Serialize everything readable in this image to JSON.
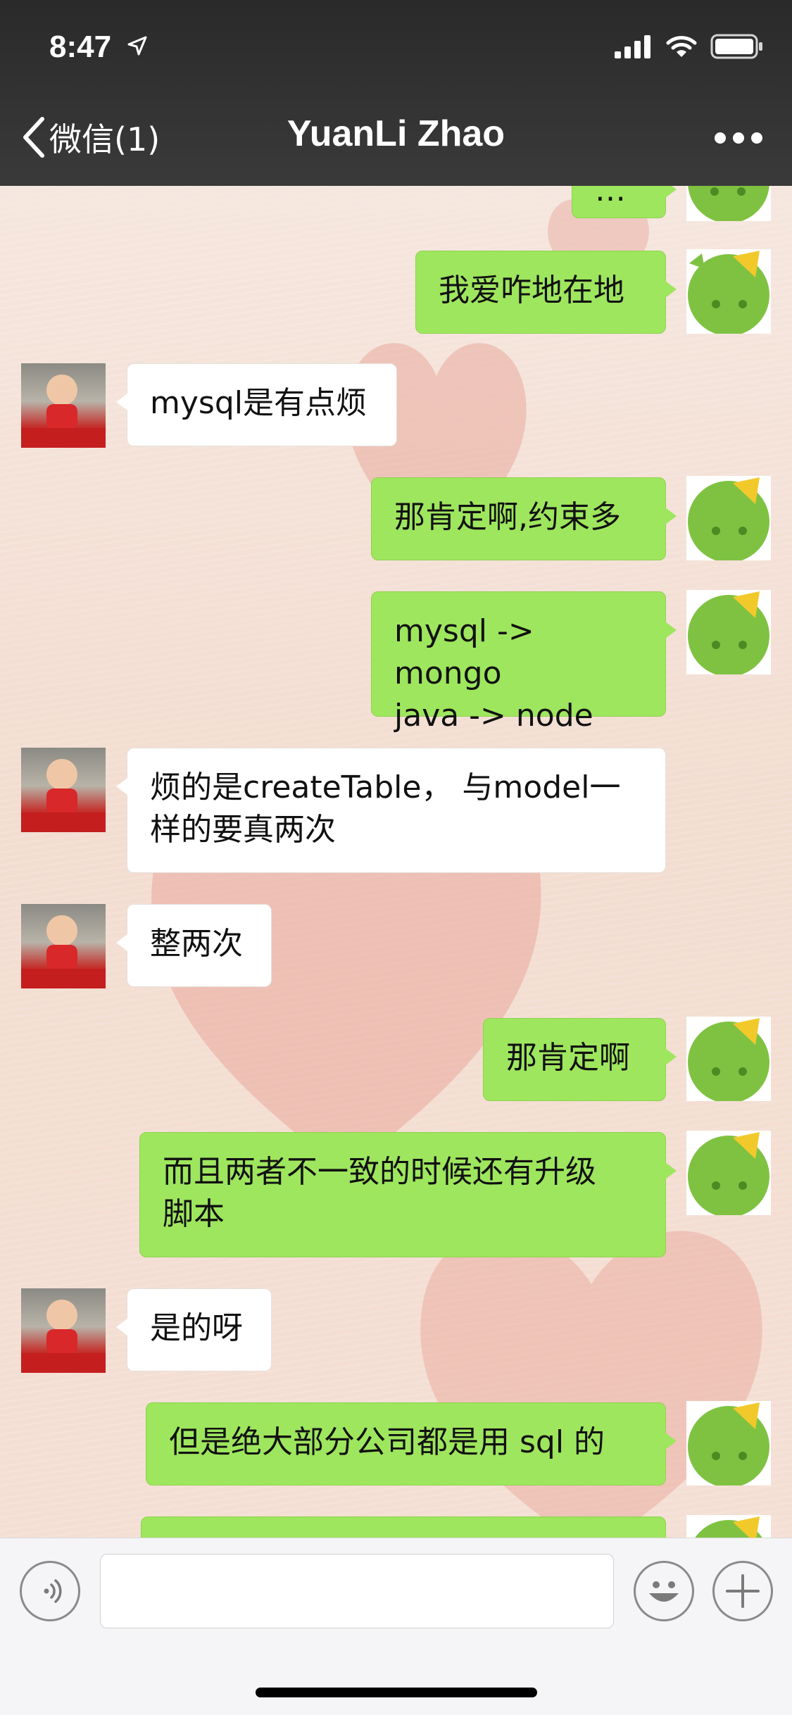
{
  "status_bar": {
    "time": "8:47"
  },
  "nav": {
    "back_label": "微信(1)",
    "title": "YuanLi Zhao"
  },
  "messages": [
    {
      "from": "me",
      "text": "…"
    },
    {
      "from": "me",
      "text": "我爱咋地在地"
    },
    {
      "from": "them",
      "text": "mysql是有点烦"
    },
    {
      "from": "me",
      "text": "那肯定啊,约束多"
    },
    {
      "from": "me",
      "text": "mysql -> mongo\njava -> node"
    },
    {
      "from": "them",
      "text": "烦的是createTable， 与model一\n样的要真两次"
    },
    {
      "from": "them",
      "text": "整两次"
    },
    {
      "from": "me",
      "text": "那肯定啊"
    },
    {
      "from": "me",
      "text": "而且两者不一致的时候还有升级\n脚本"
    },
    {
      "from": "them",
      "text": "是的呀"
    },
    {
      "from": "me",
      "text": "但是绝大部分公司都是用 sql 的"
    },
    {
      "from": "me",
      "text": ""
    }
  ],
  "input": {
    "placeholder": ""
  },
  "colors": {
    "my_bubble": "#9ee65e",
    "their_bubble": "#ffffff",
    "nav_bg": "#2f2f2f"
  },
  "icons": [
    "location-arrow-icon",
    "signal-icon",
    "wifi-icon",
    "battery-icon",
    "back-chevron-icon",
    "more-icon",
    "voice-icon",
    "emoji-icon",
    "plus-icon"
  ]
}
